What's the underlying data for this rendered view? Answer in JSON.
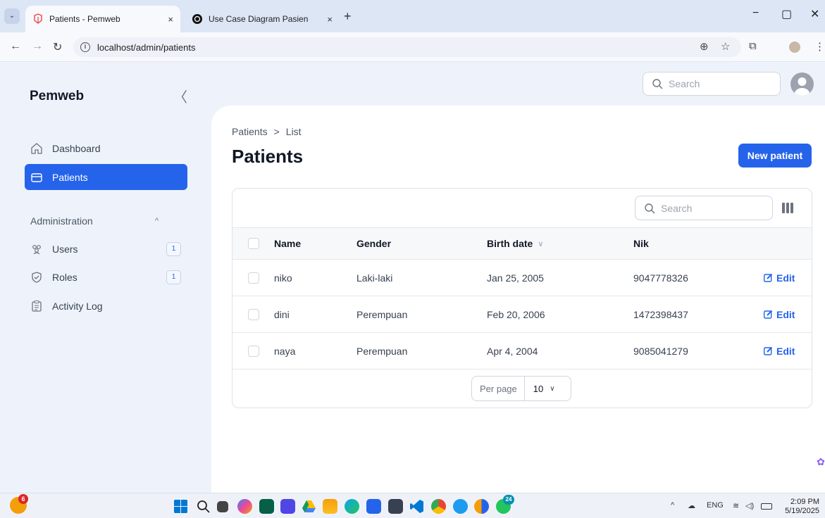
{
  "browser": {
    "tabs": [
      {
        "title": "Patients - Pemweb",
        "close": "×"
      },
      {
        "title": "Use Case Diagram Pasien",
        "close": "×"
      }
    ],
    "tab_menu_glyph": "⌄",
    "new_tab_glyph": "+",
    "url": "localhost/admin/patients",
    "window_controls": {
      "minimize": "−",
      "maximize": "▢",
      "close": "✕"
    },
    "nav": {
      "back": "←",
      "forward": "→",
      "reload": "↻"
    },
    "addr_icons": {
      "translate": "⊕",
      "star": "☆",
      "extensions": "⧉",
      "menu": "⋮"
    }
  },
  "app": {
    "brand": "Pemweb",
    "collapse_glyph": "〈",
    "header_search_placeholder": "Search",
    "sidebar": {
      "items": [
        {
          "label": "Dashboard",
          "icon": "home-icon",
          "active": false
        },
        {
          "label": "Patients",
          "icon": "folder-icon",
          "active": true
        }
      ],
      "group": {
        "label": "Administration",
        "chevron": "^",
        "items": [
          {
            "label": "Users",
            "icon": "users-icon",
            "badge": "1"
          },
          {
            "label": "Roles",
            "icon": "shield-icon",
            "badge": "1"
          },
          {
            "label": "Activity Log",
            "icon": "clipboard-icon"
          }
        ]
      }
    },
    "breadcrumb": [
      "Patients",
      ">",
      "List"
    ],
    "page_title": "Patients",
    "new_button": "New patient",
    "table": {
      "search_placeholder": "Search",
      "columns": [
        "Name",
        "Gender",
        "Birth date",
        "Nik"
      ],
      "sort_glyph": "∨",
      "rows": [
        {
          "name": "niko",
          "gender": "Laki-laki",
          "birth_date": "Jan 25, 2005",
          "nik": "9047778326"
        },
        {
          "name": "dini",
          "gender": "Perempuan",
          "birth_date": "Feb 20, 2006",
          "nik": "1472398437"
        },
        {
          "name": "naya",
          "gender": "Perempuan",
          "birth_date": "Apr 4, 2004",
          "nik": "9085041279"
        }
      ],
      "edit_label": "Edit",
      "per_page_label": "Per page",
      "per_page_value": "10",
      "per_page_chevron": "∨"
    }
  },
  "taskbar": {
    "weather_badge": "6",
    "tray": {
      "up": "^",
      "cloud": "☁",
      "lang": "ENG"
    },
    "time": "2:09 PM",
    "date": "5/19/2025",
    "icons": [
      "start-icon",
      "search-icon",
      "task-view-icon",
      "copilot-icon",
      "calendar-app-icon",
      "notes-app-icon",
      "drive-icon",
      "file-explorer-icon",
      "edge-icon",
      "word-icon",
      "terminal-icon",
      "vscode-icon",
      "chrome-icon",
      "docker-icon",
      "chrome-dev-icon",
      "whatsapp-icon"
    ],
    "whatsapp_badge": "24"
  },
  "colors": {
    "accent": "#2563eb",
    "sidebar_bg": "#eef3fb"
  }
}
